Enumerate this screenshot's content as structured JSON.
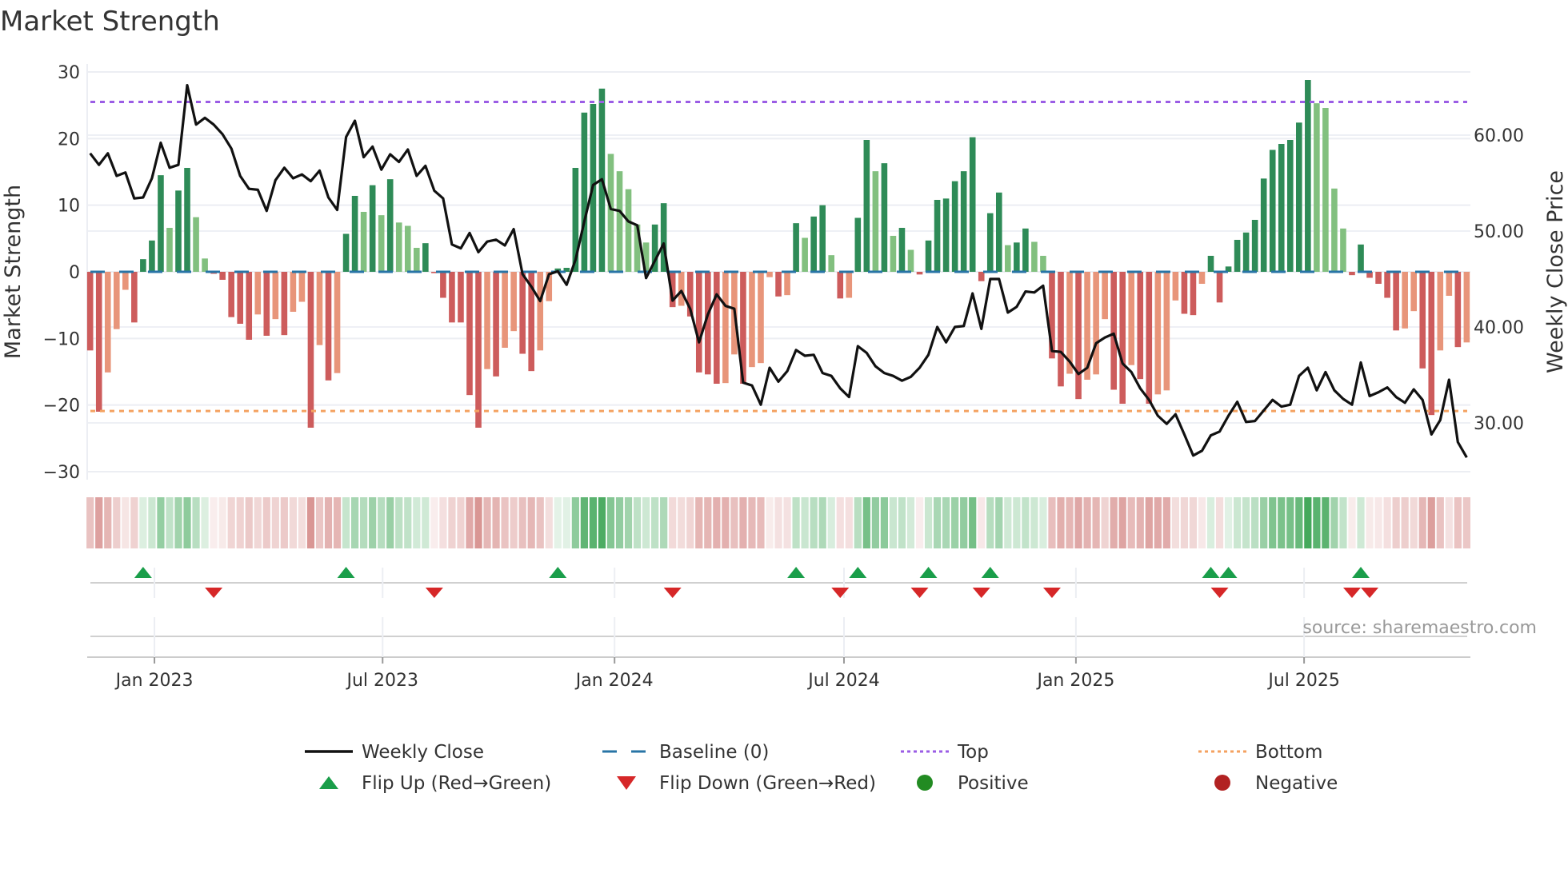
{
  "chart_data": {
    "type": "bar",
    "title": "Market Strength",
    "ylabel": "Market Strength",
    "ylabel_right": "Weekly Close Price",
    "ylim": [
      -30,
      30
    ],
    "ylim_right": [
      25.6,
      67.5
    ],
    "start_week": "2022-11-11",
    "x_ticks": [
      {
        "date": "2023-01-01",
        "label": "Jan 2023"
      },
      {
        "date": "2023-07-01",
        "label": "Jul 2023"
      },
      {
        "date": "2024-01-01",
        "label": "Jan 2024"
      },
      {
        "date": "2024-07-01",
        "label": "Jul 2024"
      },
      {
        "date": "2025-01-01",
        "label": "Jan 2025"
      },
      {
        "date": "2025-07-01",
        "label": "Jul 2025"
      }
    ],
    "y_ticks": [
      {
        "value": 30,
        "label": "30"
      },
      {
        "value": 20,
        "label": "20"
      },
      {
        "value": 10,
        "label": "10"
      },
      {
        "value": 0,
        "label": "0"
      },
      {
        "value": -10,
        "label": "−10"
      },
      {
        "value": -20,
        "label": "−20"
      },
      {
        "value": -30,
        "label": "−30"
      }
    ],
    "y_ticks_right": [
      {
        "value": 60,
        "label": "60.00"
      },
      {
        "value": 50,
        "label": "50.00"
      },
      {
        "value": 40,
        "label": "40.00"
      },
      {
        "value": 30,
        "label": "30.00"
      }
    ],
    "top_level": 25.5,
    "bottom_level": -20.9,
    "baseline": 0,
    "strength": [
      -11.8,
      -21,
      -15.1,
      -8.6,
      -2.7,
      -7.6,
      1.9,
      4.7,
      14.5,
      6.6,
      12.2,
      15.6,
      8.2,
      2.0,
      -0.3,
      -1.2,
      -6.8,
      -7.8,
      -10.2,
      -6.4,
      -9.6,
      -7.1,
      -9.5,
      -6.0,
      -4.5,
      -23.4,
      -11.0,
      -16.3,
      -15.2,
      5.7,
      11.4,
      9.0,
      13.0,
      8.5,
      13.9,
      7.4,
      6.9,
      3.6,
      4.3,
      -0.2,
      -3.9,
      -7.6,
      -7.6,
      -18.5,
      -23.4,
      -14.6,
      -15.7,
      -11.4,
      -8.9,
      -12.3,
      -14.9,
      -11.8,
      -4.4,
      0.5,
      0.6,
      15.6,
      23.9,
      25.2,
      27.5,
      17.7,
      15.1,
      12.4,
      7.1,
      4.4,
      7.1,
      10.3,
      -5.3,
      -5.1,
      -6.7,
      -15.1,
      -15.4,
      -16.8,
      -16.7,
      -12.4,
      -16.8,
      -14.3,
      -13.7,
      -0.8,
      -3.7,
      -3.5,
      7.3,
      5.1,
      8.3,
      10.0,
      2.5,
      -4.0,
      -3.9,
      8.1,
      19.8,
      15.1,
      16.3,
      5.4,
      6.6,
      3.3,
      -0.4,
      4.7,
      10.8,
      11.0,
      13.6,
      15.1,
      20.2,
      -1.4,
      8.8,
      11.9,
      4.0,
      4.4,
      6.5,
      4.5,
      2.4,
      -13.0,
      -17.2,
      -15.3,
      -19.1,
      -16.2,
      -15.4,
      -7.1,
      -17.7,
      -19.8,
      -14.0,
      -16.1,
      -19.8,
      -18.4,
      -17.8,
      -4.3,
      -6.3,
      -6.5,
      -1.8,
      2.4,
      -4.6,
      0.8,
      4.8,
      5.9,
      7.8,
      14.0,
      18.3,
      19.2,
      19.8,
      22.4,
      28.8,
      25.3,
      24.6,
      12.5,
      6.5,
      -0.5,
      4.1,
      -0.9,
      -1.8,
      -3.9,
      -8.8,
      -8.5,
      -5.9,
      -14.5,
      -21.5,
      -11.8,
      -3.6,
      -11.3,
      -10.6
    ],
    "weekly_close": [
      58.1,
      56.9,
      58.1,
      55.75,
      56.1,
      53.4,
      53.5,
      55.5,
      59.2,
      56.6,
      56.9,
      65.2,
      61.1,
      61.8,
      61.1,
      60.1,
      58.6,
      55.75,
      54.4,
      54.3,
      52.1,
      55.3,
      56.6,
      55.5,
      55.9,
      55.2,
      56.3,
      53.5,
      52.2,
      59.8,
      61.5,
      57.7,
      58.8,
      56.4,
      58.0,
      57.2,
      58.5,
      55.75,
      56.8,
      54.2,
      53.4,
      48.6,
      48.2,
      49.8,
      47.8,
      48.9,
      49.1,
      48.5,
      50.2,
      45.5,
      44.2,
      42.7,
      45.5,
      45.8,
      44.4,
      47.0,
      51.0,
      54.8,
      55.4,
      52.3,
      52.1,
      51.0,
      50.6,
      45.1,
      46.9,
      48.7,
      42.75,
      43.75,
      41.9,
      38.4,
      41.3,
      43.4,
      42.2,
      41.9,
      34.2,
      33.9,
      31.9,
      35.75,
      34.3,
      35.4,
      37.6,
      37.0,
      37.1,
      35.2,
      34.9,
      33.6,
      32.7,
      38.0,
      37.3,
      35.9,
      35.2,
      34.9,
      34.4,
      34.8,
      35.75,
      37.1,
      40.0,
      38.4,
      40.0,
      40.1,
      43.5,
      39.8,
      45.0,
      45.0,
      41.5,
      42.1,
      43.7,
      43.6,
      44.3,
      37.5,
      37.4,
      36.4,
      35.1,
      35.75,
      38.3,
      38.9,
      39.3,
      36.2,
      35.3,
      33.6,
      32.4,
      30.75,
      29.9,
      30.9,
      28.8,
      26.6,
      27.1,
      28.7,
      29.1,
      30.75,
      32.2,
      30.1,
      30.2,
      31.3,
      32.4,
      31.7,
      31.9,
      34.9,
      35.75,
      33.4,
      35.3,
      33.4,
      32.5,
      31.9,
      36.3,
      32.8,
      33.2,
      33.7,
      32.7,
      32.1,
      33.5,
      32.4,
      28.8,
      30.3,
      34.5,
      28.0,
      26.4
    ],
    "legend": {
      "placement": "bottom",
      "items": [
        {
          "key": "close",
          "label": "Weekly Close"
        },
        {
          "key": "baseline",
          "label": "Baseline (0)"
        },
        {
          "key": "top",
          "label": "Top"
        },
        {
          "key": "bottom",
          "label": "Bottom"
        },
        {
          "key": "flip_up",
          "label": "Flip Up (Red→Green)"
        },
        {
          "key": "flip_down",
          "label": "Flip Down (Green→Red)"
        },
        {
          "key": "positive",
          "label": "Positive"
        },
        {
          "key": "negative",
          "label": "Negative"
        }
      ]
    },
    "source": "source: sharemaestro.com",
    "colors": {
      "strong_pos": "#2e8b57",
      "weak_pos": "#82c07f",
      "strong_neg": "#cd5c5c",
      "weak_neg": "#e8957a",
      "close": "#111111",
      "baseline": "#2874a6",
      "top": "#9b5de5",
      "bottom": "#f4a261",
      "flip_up": "#1a9e4a",
      "flip_down": "#d62728",
      "positive": "#228b22",
      "negative": "#b22222",
      "band_pos": "#2e9e48",
      "band_neg": "#c0504d"
    }
  }
}
